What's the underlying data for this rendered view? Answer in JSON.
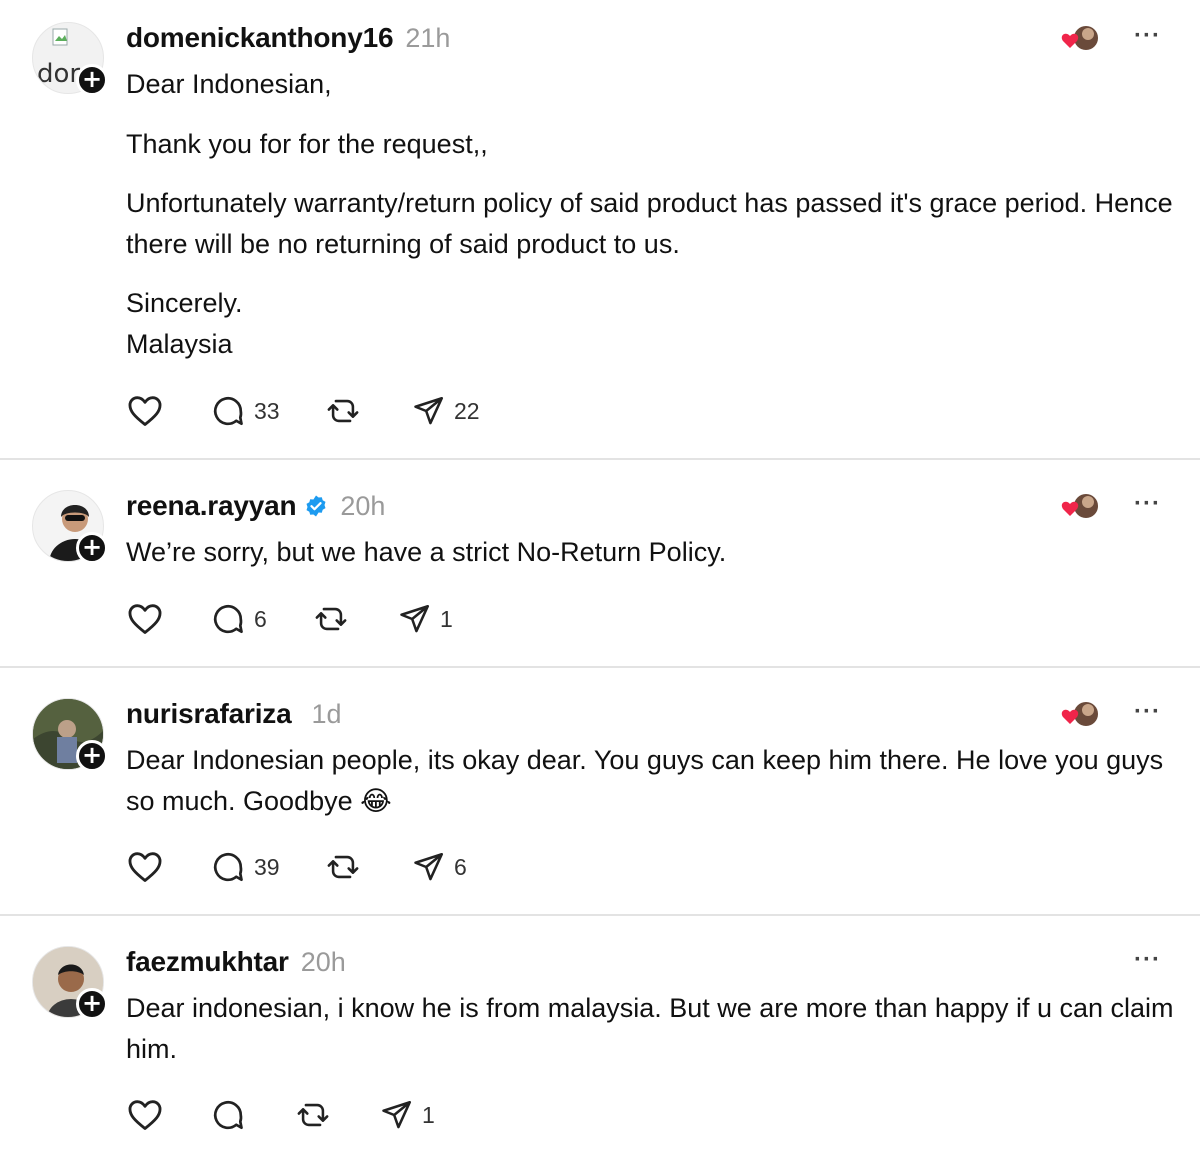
{
  "posts": [
    {
      "username": "domenickanthony16",
      "time": "21h",
      "verified": false,
      "avatar_fallback": "dor",
      "paragraphs": [
        "Dear Indonesian,",
        "Thank you for for the request,,",
        "Unfortunately warranty/return policy of said product has passed it's grace period. Hence there will be no returning of said product to us.",
        "Sincerely.\nMalaysia"
      ],
      "counts": {
        "reply": "33",
        "send": "22"
      },
      "follow_badge": "+",
      "more": "···"
    },
    {
      "username": "reena.rayyan",
      "time": "20h",
      "verified": true,
      "paragraphs": [
        "We’re sorry, but we have a strict No-Return Policy."
      ],
      "counts": {
        "reply": "6",
        "send": "1"
      },
      "follow_badge": "+",
      "more": "···"
    },
    {
      "username": "nurisrafariza",
      "time": "1d",
      "verified": false,
      "paragraphs": [
        "Dear Indonesian people, its okay dear. You guys can keep him there. He love you guys so much. Goodbye 😂"
      ],
      "counts": {
        "reply": "39",
        "send": "6"
      },
      "follow_badge": "+",
      "more": "···"
    },
    {
      "username": "faezmukhtar",
      "time": "20h",
      "verified": false,
      "paragraphs": [
        "Dear indonesian, i know he is from malaysia. But we are more than happy if u can claim him."
      ],
      "counts": {
        "reply": "",
        "send": "1"
      },
      "follow_badge": "+",
      "more": "···"
    }
  ],
  "icons": {
    "like": "heart-icon",
    "reply": "comment-icon",
    "repost": "repost-icon",
    "send": "share-icon",
    "verified": "verified-badge-icon",
    "likers": "liker-avatars-icon"
  },
  "colors": {
    "verified": "#1d9bf0",
    "heart": "#f0254a",
    "divider": "#e3e3e3",
    "muted": "#9a9a9a"
  }
}
